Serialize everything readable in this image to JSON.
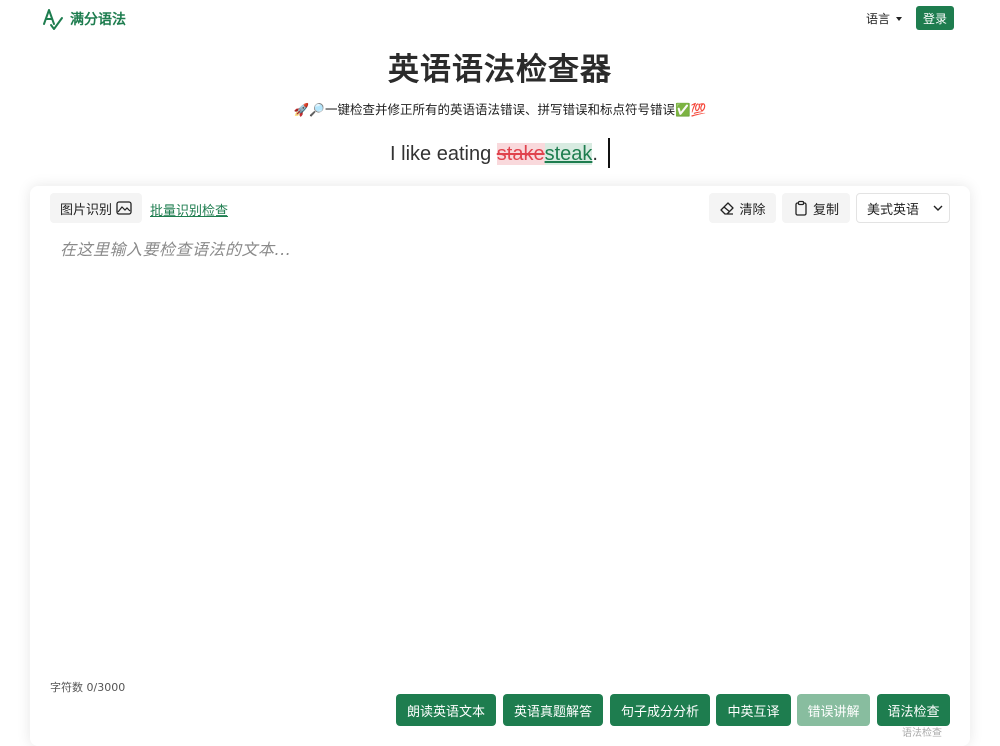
{
  "header": {
    "logo_text": "满分语法",
    "language_label": "语言",
    "login_label": "登录"
  },
  "hero": {
    "title": "英语语法检查器",
    "subtitle": "🚀🔎一键检查并修正所有的英语语法错误、拼写错误和标点符号错误✅💯",
    "demo_prefix": "I like eating ",
    "demo_wrong": "stake",
    "demo_correct": "steak",
    "demo_suffix": "."
  },
  "toolbar": {
    "image_ocr_label": "图片识别",
    "batch_link_label": "批量识别检查",
    "clear_label": "清除",
    "copy_label": "复制",
    "dialect_value": "美式英语"
  },
  "editor": {
    "placeholder": "在这里输入要检查语法的文本..."
  },
  "footer": {
    "char_count": "字符数 0/3000",
    "note": "语法检查"
  },
  "actions": {
    "read_aloud": "朗读英语文本",
    "exam_answers": "英语真题解答",
    "sentence_analysis": "句子成分分析",
    "translate": "中英互译",
    "error_explain": "错误讲解",
    "grammar_check": "语法检查"
  },
  "colors": {
    "brand_green": "#1e7d4f",
    "disabled_green": "#88bd9f",
    "error_red": "#e0434d"
  }
}
